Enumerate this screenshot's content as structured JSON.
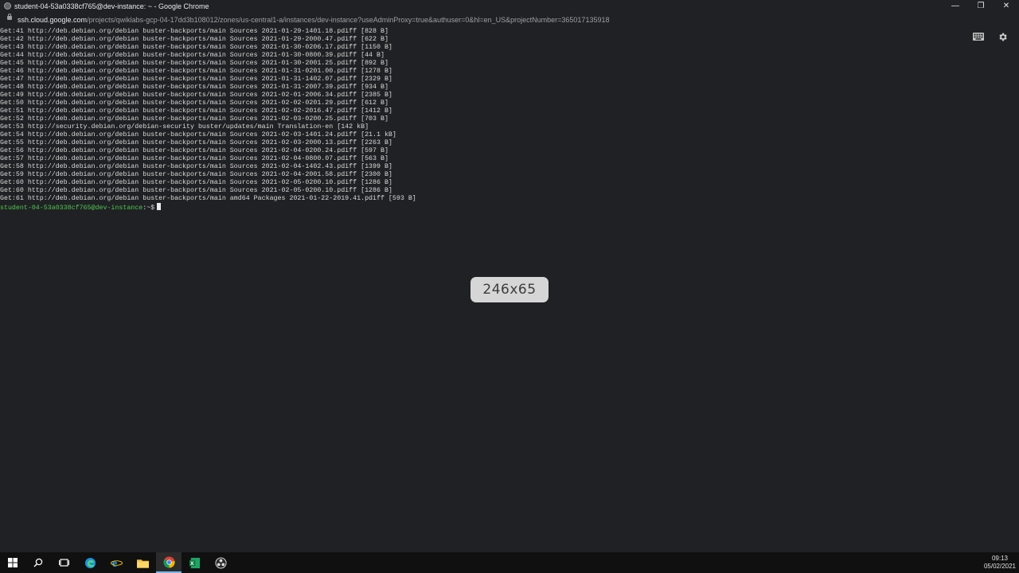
{
  "window": {
    "title": "student-04-53a0338cf765@dev-instance: ~ - Google Chrome",
    "controls": {
      "minimize": "—",
      "restore": "❐",
      "close": "✕"
    }
  },
  "address_bar": {
    "url_host": "ssh.cloud.google.com",
    "url_path": "/projects/qwiklabs-gcp-04-17dd3b108012/zones/us-central1-a/instances/dev-instance?useAdminProxy=true&authuser=0&hl=en_US&projectNumber=365017135918"
  },
  "terminal": {
    "lines": [
      "Get:41 http://deb.debian.org/debian buster-backports/main Sources 2021-01-29-1401.18.pdiff [828 B]",
      "Get:42 http://deb.debian.org/debian buster-backports/main Sources 2021-01-29-2000.47.pdiff [622 B]",
      "Get:43 http://deb.debian.org/debian buster-backports/main Sources 2021-01-30-0206.17.pdiff [1150 B]",
      "Get:44 http://deb.debian.org/debian buster-backports/main Sources 2021-01-30-0800.39.pdiff [44 B]",
      "Get:45 http://deb.debian.org/debian buster-backports/main Sources 2021-01-30-2001.25.pdiff [892 B]",
      "Get:46 http://deb.debian.org/debian buster-backports/main Sources 2021-01-31-0201.00.pdiff [1278 B]",
      "Get:47 http://deb.debian.org/debian buster-backports/main Sources 2021-01-31-1402.07.pdiff [2329 B]",
      "Get:48 http://deb.debian.org/debian buster-backports/main Sources 2021-01-31-2007.39.pdiff [934 B]",
      "Get:49 http://deb.debian.org/debian buster-backports/main Sources 2021-02-01-2006.34.pdiff [2385 B]",
      "Get:50 http://deb.debian.org/debian buster-backports/main Sources 2021-02-02-0201.29.pdiff [612 B]",
      "Get:51 http://deb.debian.org/debian buster-backports/main Sources 2021-02-02-2016.47.pdiff [1412 B]",
      "Get:52 http://deb.debian.org/debian buster-backports/main Sources 2021-02-03-0200.25.pdiff [703 B]",
      "Get:53 http://security.debian.org/debian-security buster/updates/main Translation-en [142 kB]",
      "Get:54 http://deb.debian.org/debian buster-backports/main Sources 2021-02-03-1401.24.pdiff [21.1 kB]",
      "Get:55 http://deb.debian.org/debian buster-backports/main Sources 2021-02-03-2000.13.pdiff [2263 B]",
      "Get:56 http://deb.debian.org/debian buster-backports/main Sources 2021-02-04-0200.24.pdiff [597 B]",
      "Get:57 http://deb.debian.org/debian buster-backports/main Sources 2021-02-04-0800.07.pdiff [563 B]",
      "Get:58 http://deb.debian.org/debian buster-backports/main Sources 2021-02-04-1402.43.pdiff [1399 B]",
      "Get:59 http://deb.debian.org/debian buster-backports/main Sources 2021-02-04-2001.58.pdiff [2300 B]",
      "Get:60 http://deb.debian.org/debian buster-backports/main Sources 2021-02-05-0200.10.pdiff [1286 B]",
      "Get:60 http://deb.debian.org/debian buster-backports/main Sources 2021-02-05-0200.10.pdiff [1286 B]",
      "Get:61 http://deb.debian.org/debian buster-backports/main amd64 Packages 2021-01-22-2019.41.pdiff [593 B]"
    ],
    "prompt_user": "student-04-53a0338cf765@dev-instance",
    "prompt_symbol": ":~$",
    "size_tooltip": "246x65",
    "icons": {
      "keyboard": "keyboard-icon",
      "settings": "gear-icon"
    }
  },
  "taskbar": {
    "items": [
      "windows-start-icon",
      "search-icon",
      "task-view-icon",
      "edge-icon",
      "ie-icon",
      "file-explorer-icon",
      "chrome-icon",
      "excel-icon",
      "obs-icon"
    ],
    "time": "09:13",
    "date": "05/02/2021"
  },
  "colors": {
    "background": "#202124",
    "prompt_green": "#4ec94e",
    "text": "#d9d9d9",
    "taskbar": "#101010"
  }
}
